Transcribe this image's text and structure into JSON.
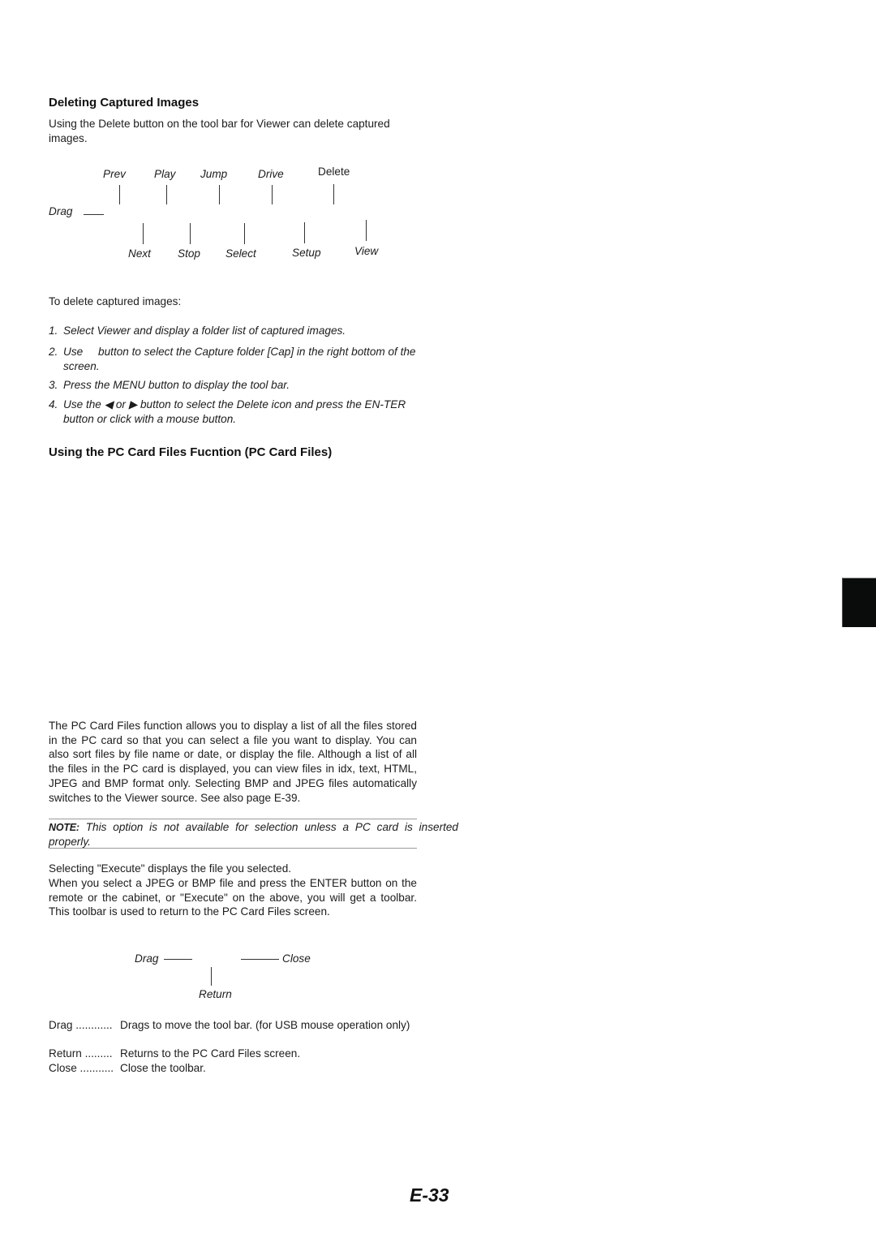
{
  "section1": {
    "heading": "Deleting Captured Images",
    "intro": "Using the Delete button on the tool bar for Viewer can delete captured images.",
    "toolbar_diagram": {
      "top_labels": [
        "Prev",
        "Play",
        "Jump",
        "Drive",
        "Delete"
      ],
      "bottom_labels": [
        "Next",
        "Stop",
        "Select",
        "Setup",
        "View"
      ],
      "left_label": "Drag"
    },
    "procedure_intro": "To delete captured images:",
    "steps": [
      {
        "num": "1.",
        "text": "Select Viewer and display a folder list of captured images."
      },
      {
        "num": "2.",
        "text": "Use     button to select the Capture folder [Cap] in the right bottom of the screen."
      },
      {
        "num": "3.",
        "text": "Press the MENU button to display the tool bar."
      },
      {
        "num": "4.",
        "text": "Use the ◀ or ▶ button to select the Delete icon and press the EN-TER button or click with a mouse button."
      }
    ]
  },
  "section2": {
    "heading": "Using the PC Card Files Fucntion (PC Card Files)",
    "description": "The PC Card Files function allows you to display a list of all the files stored in the PC card so that you can select a file you want to display. You can also sort files by file name or date, or display the file. Although a list of all the files in the PC card is displayed, you can view files in idx, text, HTML, JPEG and BMP format only. Selecting BMP and JPEG files automatically switches to the Viewer source. See also page E-39.",
    "note_label": "NOTE:",
    "note_text": " This option is not available for selection unless a PC card is inserted properly.",
    "execute_line": "Selecting \"Execute\" displays the file you selected.",
    "toolbar_para": "When you select a JPEG or BMP file and press the ENTER button on the remote or the cabinet, or \"Execute\" on the above, you will get a toolbar. This toolbar is used to return to the PC Card Files screen.",
    "mini_toolbar_diagram": {
      "left_label": "Drag",
      "right_label": "Close",
      "bottom_label": "Return"
    },
    "definitions": [
      {
        "term": "Drag ............",
        "def": "Drags to move the tool bar. (for USB mouse operation only)"
      },
      {
        "term": "Return .........",
        "def": "Returns to the PC Card Files screen."
      },
      {
        "term": "Close ...........",
        "def": "Close the toolbar."
      }
    ]
  },
  "page_number": "E-33"
}
